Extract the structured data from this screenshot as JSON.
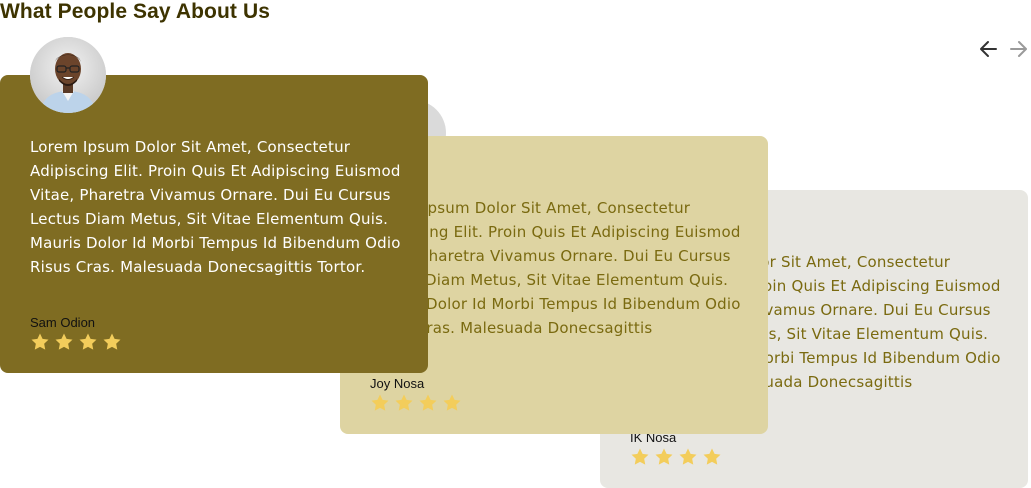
{
  "section": {
    "title": "What People Say About Us"
  },
  "carousel": {
    "prev_label": "previous",
    "next_label": "next",
    "testimonials": [
      {
        "text": "Lorem Ipsum Dolor Sit Amet, Consectetur Adipiscing Elit. Proin Quis Et Adipiscing Euismod Vitae, Pharetra Vivamus Ornare. Dui Eu Cursus Lectus Diam Metus, Sit Vitae Elementum Quis. Mauris Dolor Id Morbi Tempus Id Bibendum Odio Risus Cras. Malesuada Donecsagittis Tortor.",
        "name": "Sam Odion",
        "rating": 4
      },
      {
        "text": "Lorem Ipsum Dolor Sit Amet, Consectetur Adipiscing Elit. Proin Quis Et Adipiscing Euismod Vitae, Pharetra Vivamus Ornare. Dui Eu Cursus Lectus Diam Metus, Sit Vitae Elementum Quis. Mauris Dolor Id Morbi Tempus Id Bibendum Odio Risus Cras. Malesuada Donecsagittis",
        "name": "Joy Nosa",
        "rating": 4
      },
      {
        "text": "Lorem Ipsum Dolor Sit Amet, Consectetur Adipiscing Elit. Proin Quis Et Adipiscing Euismod Vitae, Pharetra Vivamus Ornare. Dui Eu Cursus Lectus Diam Metus, Sit Vitae Elementum Quis. Mauris Dolor Id Morbi Tempus Id Bibendum Odio Risus Cras. Malesuada Donecsagittis",
        "name": "IK Nosa",
        "rating": 4
      }
    ]
  },
  "colors": {
    "title": "#3d3300",
    "card_front": "#7f6c22",
    "card_middle": "#ded4a2",
    "card_back": "#e8e7e2",
    "star": "#f3cd5b"
  },
  "icons": {
    "prev": "arrow-left-icon",
    "next": "arrow-right-icon",
    "star": "star-icon"
  }
}
